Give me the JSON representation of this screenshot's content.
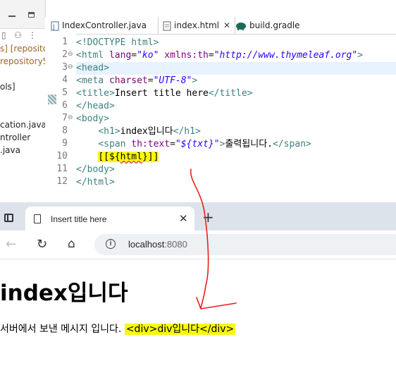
{
  "ide": {
    "left_panel": {
      "lines": [
        {
          "text": "s] [repositor",
          "style": "repo"
        },
        {
          "text": "repository5",
          "style": "repo"
        },
        {
          "text": "ols]",
          "style": "plain"
        },
        {
          "text": "cation.java",
          "style": "plain"
        },
        {
          "text": "ntroller",
          "style": "plain"
        },
        {
          "text": ".java",
          "style": "plain"
        }
      ]
    },
    "tabs": [
      {
        "label": "IndexController.java",
        "icon": "java-file-icon"
      },
      {
        "label": "index.html",
        "icon": "html-file-icon",
        "active": true
      },
      {
        "label": "build.gradle",
        "icon": "gradle-elephant-icon"
      }
    ],
    "tab_close": "✕",
    "line_numbers": [
      "1",
      "2",
      "3",
      "4",
      "5",
      "6",
      "7",
      "8",
      "9",
      "10",
      "11",
      "12"
    ],
    "highlight_color": "#f9f90e"
  },
  "browser": {
    "tab_title": "Insert title here",
    "tab_close": "✕",
    "new_tab": "+",
    "url_host": "localhost",
    "url_port": ":8080",
    "page": {
      "heading": "index입니다",
      "message": "서버에서 보낸 메시지 입니다.",
      "html_output": "<div>div입니다</div>"
    }
  },
  "annotation": {
    "arrow_color": "#e8201a"
  }
}
